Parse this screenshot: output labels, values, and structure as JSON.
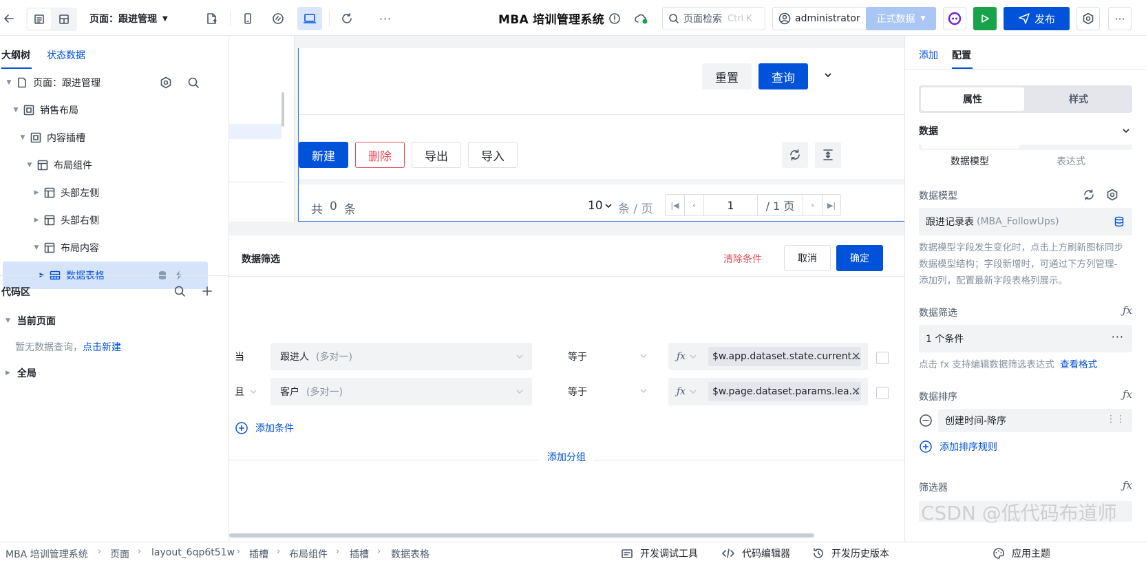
{
  "topbar": {
    "page_selector": "页面：跟进管理",
    "app_title": "MBA 培训管理系统",
    "search_placeholder": "页面检索",
    "search_shortcut": "Ctrl K",
    "user": "administrator",
    "env": "正式数据",
    "publish": "发布"
  },
  "left": {
    "tabs": [
      "大纲树",
      "状态数据"
    ],
    "tree": [
      {
        "label": "页面：跟进管理"
      },
      {
        "label": "销售布局"
      },
      {
        "label": "内容插槽"
      },
      {
        "label": "布局组件"
      },
      {
        "label": "头部左侧"
      },
      {
        "label": "头部右侧"
      },
      {
        "label": "布局内容"
      },
      {
        "label": "数据表格"
      }
    ],
    "code_title": "代码区",
    "current_page": "当前页面",
    "no_query": "暂无数据查询，",
    "click_new": "点击新建",
    "global": "全局"
  },
  "canvas": {
    "reset": "重置",
    "query": "查询",
    "new": "新建",
    "delete": "删除",
    "export": "导出",
    "import": "导入",
    "total_prefix": "共",
    "total_count": "0",
    "total_suffix": "条",
    "page_size": "10",
    "per_page": "条 / 页",
    "current_page": "1",
    "total_pages": "/ 1 页"
  },
  "filter": {
    "title": "数据筛选",
    "clear": "清除条件",
    "cancel": "取消",
    "confirm": "确定",
    "rows": [
      {
        "conj": "当",
        "field": "跟进人",
        "field_hint": "(多对一)",
        "op": "等于",
        "value": "$w.app.dataset.state.current..."
      },
      {
        "conj": "且",
        "field": "客户",
        "field_hint": "(多对一)",
        "op": "等于",
        "value": "$w.page.dataset.params.lea..."
      }
    ],
    "add_condition": "添加条件",
    "add_group": "添加分组"
  },
  "right": {
    "tabs": [
      "添加",
      "配置"
    ],
    "seg": [
      "属性",
      "样式"
    ],
    "data_section": "数据",
    "sub_tabs": [
      "数据模型",
      "表达式"
    ],
    "model_label": "数据模型",
    "model_name": "跟进记录表",
    "model_code": "(MBA_FollowUps)",
    "model_hint": "数据模型字段发生变化时，点击上方刷新图标同步数据模型结构；字段新增时，可通过下方列管理-添加列，配置最新字段表格列展示。",
    "filter_label": "数据筛选",
    "filter_value": "1 个条件",
    "filter_hint": "点击 fx 支持编辑数据筛选表达式",
    "view_format": "查看格式",
    "sort_label": "数据排序",
    "sort_rule": "创建时间-降序",
    "add_sort": "添加排序规则",
    "selector_label": "筛选器"
  },
  "bottom": {
    "crumbs": [
      "MBA 培训管理系统",
      "页面",
      "layout_6qp6t51w",
      "插槽",
      "布局组件",
      "插槽",
      "数据表格"
    ],
    "debug": "开发调试工具",
    "code_editor": "代码编辑器",
    "history": "开发历史版本",
    "theme": "应用主题"
  },
  "watermark": "CSDN @低代码布道师",
  "colors": {
    "primary": "#0052d9",
    "danger": "#e34d59",
    "env_bg": "#a9c6f5",
    "run": "#16a34a"
  }
}
